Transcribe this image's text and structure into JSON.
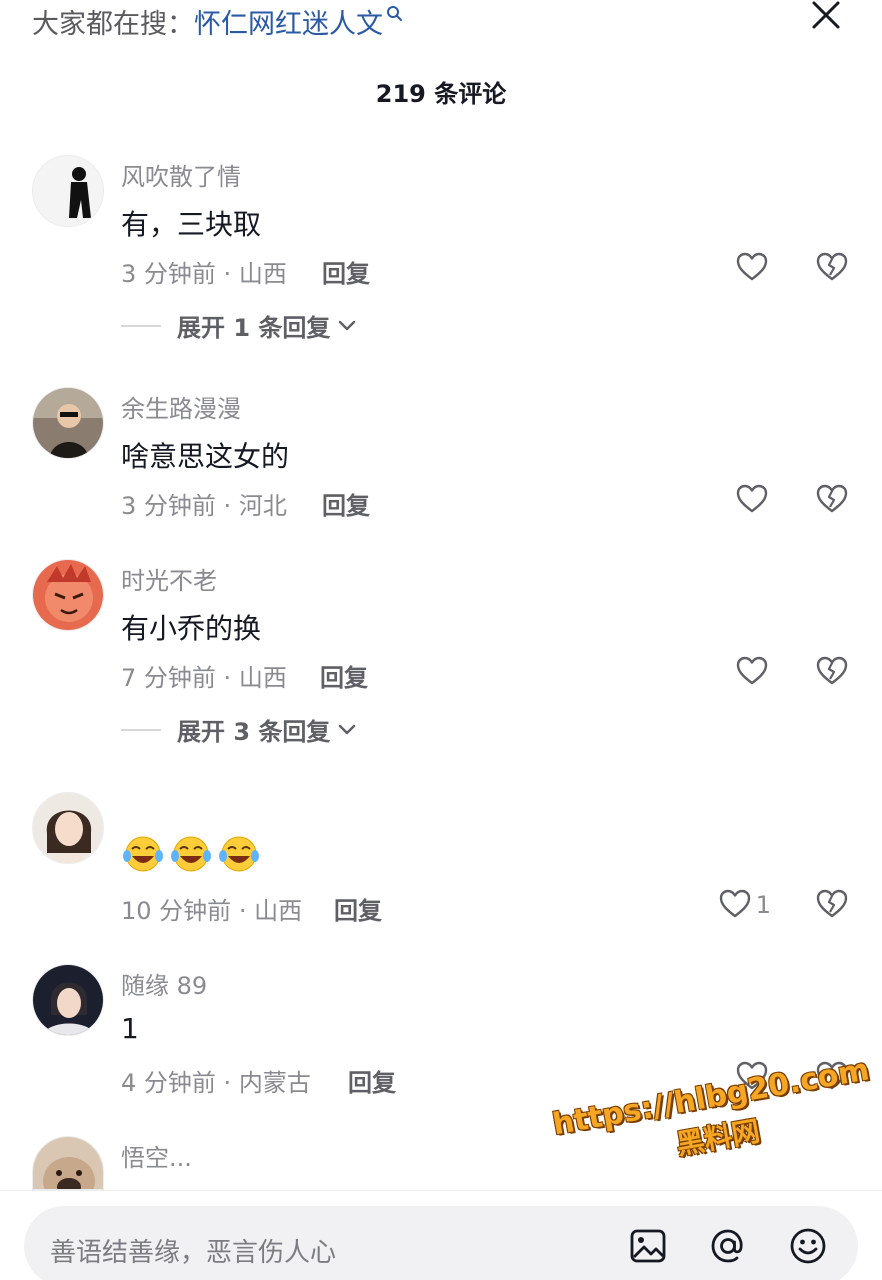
{
  "search": {
    "prefix": "大家都在搜：",
    "query": "怀仁网红迷人文"
  },
  "header": {
    "comment_count": "219 条评论"
  },
  "comments": [
    {
      "username": "风吹散了情",
      "text": "有，三块取",
      "time": "3 分钟前",
      "location": "山西",
      "reply_label": "回复",
      "expand": "展开 1 条回复"
    },
    {
      "username": "余生路漫漫",
      "text": "啥意思这女的",
      "time": "3 分钟前",
      "location": "河北",
      "reply_label": "回复"
    },
    {
      "username": "时光不老",
      "text": "有小乔的换",
      "time": "7 分钟前",
      "location": "山西",
      "reply_label": "回复",
      "expand": "展开 3 条回复"
    },
    {
      "username": "",
      "text": "",
      "emoji": [
        "laughing-tears",
        "laughing-tears",
        "laughing-tears"
      ],
      "time": "10 分钟前",
      "location": "山西",
      "reply_label": "回复",
      "likes": "1"
    },
    {
      "username": "随缘 89",
      "text": "1",
      "time": "4 分钟前",
      "location": "内蒙古",
      "reply_label": "回复"
    },
    {
      "username": "悟空...",
      "text": ""
    }
  ],
  "meta_separator": "·",
  "input": {
    "placeholder": "善语结善缘，恶言伤人心"
  },
  "icons": {
    "close": "close-icon",
    "like": "heart-outline-icon",
    "dislike": "broken-heart-icon",
    "image": "image-icon",
    "mention": "at-icon",
    "emoji": "smiley-icon"
  },
  "watermark": {
    "url": "https://hlbg20.com",
    "name": "黑料网"
  },
  "colors": {
    "link": "#2b5aa6",
    "muted": "#8a8b91",
    "watermark": "#f5a623"
  }
}
